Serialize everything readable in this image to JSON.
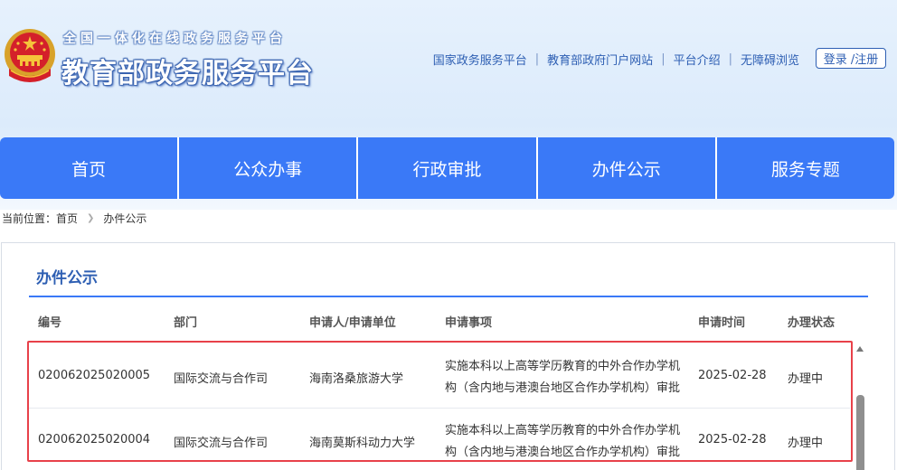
{
  "header": {
    "subtitle": "全国一体化在线政务服务平台",
    "title": "教育部政务服务平台",
    "links": [
      "国家政务服务平台",
      "教育部政府门户网站",
      "平台介绍",
      "无障碍浏览"
    ],
    "login_label": "登录 /注册"
  },
  "nav": {
    "items": [
      "首页",
      "公众办事",
      "行政审批",
      "办件公示",
      "服务专题"
    ]
  },
  "breadcrumb": {
    "prefix": "当前位置：",
    "home": "首页",
    "current": "办件公示"
  },
  "panel": {
    "title": "办件公示",
    "columns": [
      "编号",
      "部门",
      "申请人/申请单位",
      "申请事项",
      "申请时间",
      "办理状态"
    ],
    "rows": [
      {
        "id": "020062025020005",
        "dept": "国际交流与合作司",
        "applicant": "海南洛桑旅游大学",
        "item": "实施本科以上高等学历教育的中外合作办学机构（含内地与港澳台地区合作办学机构）审批",
        "date": "2025-02-28",
        "status": "办理中"
      },
      {
        "id": "020062025020004",
        "dept": "国际交流与合作司",
        "applicant": "海南莫斯科动力大学",
        "item": "实施本科以上高等学历教育的中外合作办学机构（含内地与港澳台地区合作办学机构）审批",
        "date": "2025-02-28",
        "status": "办理中"
      }
    ]
  },
  "colors": {
    "nav_bg": "#3a79f7",
    "link": "#2e5fb3",
    "highlight": "#e8414a"
  }
}
